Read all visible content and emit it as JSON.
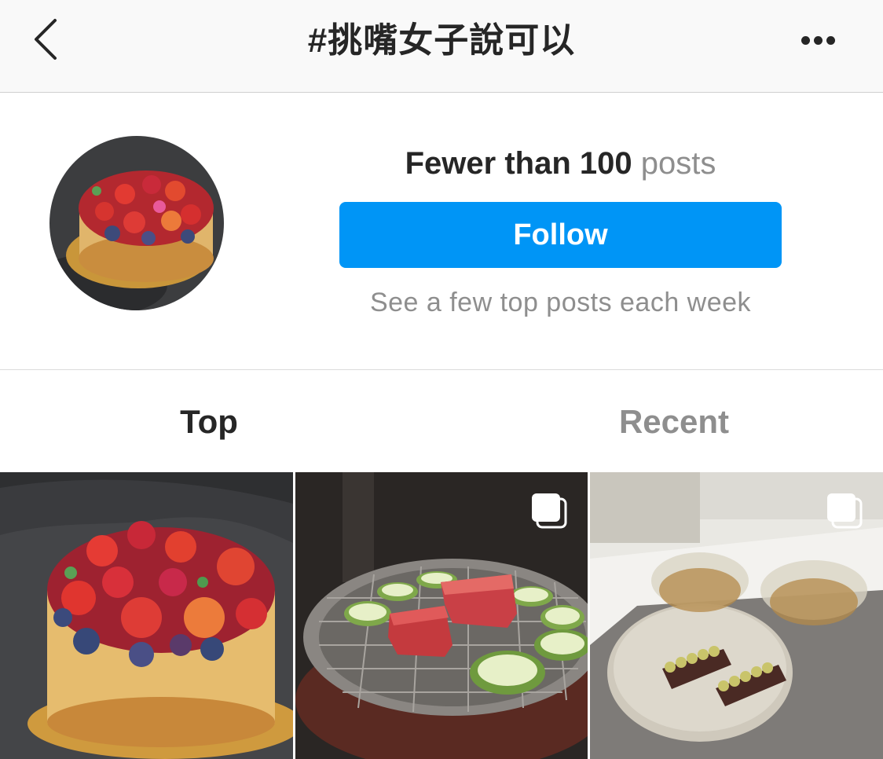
{
  "header": {
    "title": "#挑嘴女子說可以",
    "back_icon": "chevron-left-icon",
    "more_icon": "more-horizontal-icon"
  },
  "profile": {
    "count_strong": "Fewer than 100",
    "count_muted": "posts",
    "follow_label": "Follow",
    "subtitle": "See a few top posts each week"
  },
  "tabs": [
    {
      "label": "Top",
      "active": true
    },
    {
      "label": "Recent",
      "active": false
    }
  ],
  "grid": {
    "posts": [
      {
        "subject": "berry cake",
        "multiple": false
      },
      {
        "subject": "grilled wagyu and zucchini",
        "multiple": true
      },
      {
        "subject": "dessert plate with tea cups",
        "multiple": true
      }
    ]
  },
  "colors": {
    "accent": "#0095f6",
    "text": "#262626",
    "muted": "#8e8e8e",
    "header_bg": "#f9f9f9"
  }
}
